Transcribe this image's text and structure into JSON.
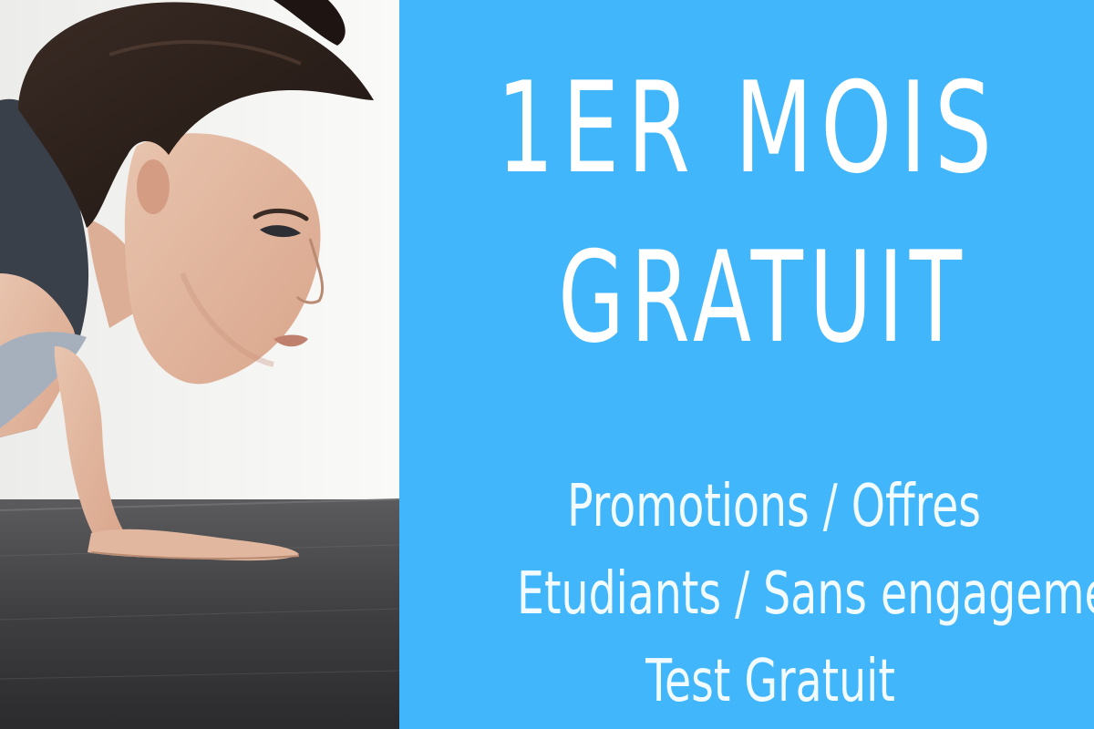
{
  "promo": {
    "headline_line1": "1ER MOIS",
    "headline_line2": "GRATUIT",
    "offers": [
      "Promotions / Offres",
      "Etudiants / Sans engagement",
      "Test Gratuit"
    ]
  },
  "colors": {
    "promo_background": "#41b6fb",
    "text": "#ffffff"
  }
}
